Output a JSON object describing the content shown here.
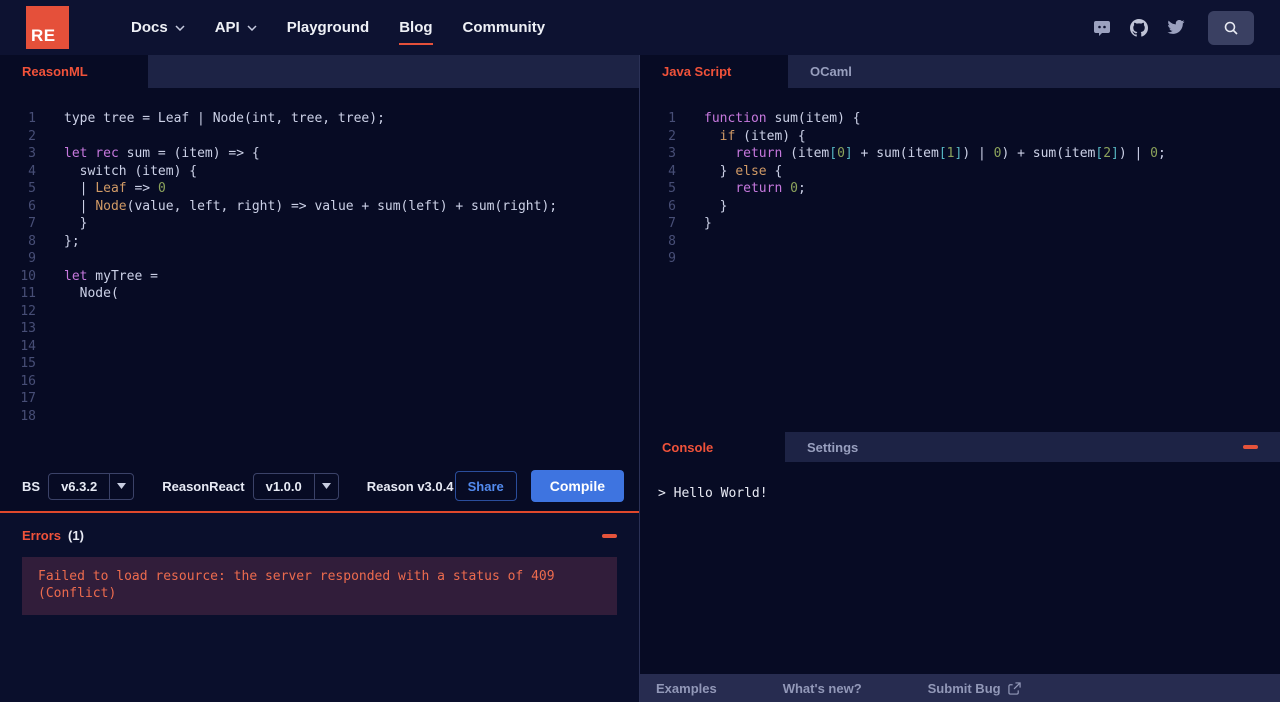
{
  "navbar": {
    "logo_text": "RE",
    "links": [
      {
        "label": "Docs",
        "caret": true,
        "active": false
      },
      {
        "label": "API",
        "caret": true,
        "active": false
      },
      {
        "label": "Playground",
        "caret": false,
        "active": false
      },
      {
        "label": "Blog",
        "caret": false,
        "active": true
      },
      {
        "label": "Community",
        "caret": false,
        "active": false
      }
    ],
    "icons": [
      "discord-icon",
      "github-icon",
      "twitter-icon",
      "search-icon"
    ]
  },
  "left_editor": {
    "tab_label": "ReasonML",
    "lines": [
      [
        {
          "c": "p",
          "t": "type tree = Leaf | Node(int, tree, tree);"
        }
      ],
      [],
      [
        {
          "c": "k",
          "t": "let rec"
        },
        {
          "c": "p",
          "t": " sum = (item) => {"
        }
      ],
      [
        {
          "c": "p",
          "t": "  switch (item) {"
        }
      ],
      [
        {
          "c": "p",
          "t": "  | "
        },
        {
          "c": "v",
          "t": "Leaf"
        },
        {
          "c": "p",
          "t": " => "
        },
        {
          "c": "n",
          "t": "0"
        }
      ],
      [
        {
          "c": "p",
          "t": "  | "
        },
        {
          "c": "v",
          "t": "Node"
        },
        {
          "c": "p",
          "t": "(value, left, right) => value + sum(left) + sum(right);"
        }
      ],
      [
        {
          "c": "p",
          "t": "  }"
        }
      ],
      [
        {
          "c": "p",
          "t": "};"
        }
      ],
      [],
      [
        {
          "c": "k",
          "t": "let"
        },
        {
          "c": "p",
          "t": " myTree ="
        }
      ],
      [
        {
          "c": "p",
          "t": "  Node("
        }
      ],
      [],
      [],
      [],
      [],
      [],
      [],
      []
    ]
  },
  "right_editor": {
    "tabs": [
      {
        "label": "Java Script"
      },
      {
        "label": "OCaml"
      }
    ],
    "lines": [
      [
        {
          "c": "k",
          "t": "function"
        },
        {
          "c": "p",
          "t": " sum(item) {"
        }
      ],
      [
        {
          "c": "p",
          "t": "  "
        },
        {
          "c": "v",
          "t": "if"
        },
        {
          "c": "p",
          "t": " (item) {"
        }
      ],
      [
        {
          "c": "p",
          "t": "    "
        },
        {
          "c": "k",
          "t": "return"
        },
        {
          "c": "p",
          "t": " (item"
        },
        {
          "c": "b",
          "t": "["
        },
        {
          "c": "n",
          "t": "0"
        },
        {
          "c": "b",
          "t": "]"
        },
        {
          "c": "p",
          "t": " + sum(item"
        },
        {
          "c": "b",
          "t": "["
        },
        {
          "c": "n",
          "t": "1"
        },
        {
          "c": "b",
          "t": "]"
        },
        {
          "c": "p",
          "t": ") | "
        },
        {
          "c": "n",
          "t": "0"
        },
        {
          "c": "p",
          "t": ") + sum(item"
        },
        {
          "c": "b",
          "t": "["
        },
        {
          "c": "n",
          "t": "2"
        },
        {
          "c": "b",
          "t": "]"
        },
        {
          "c": "p",
          "t": ") | "
        },
        {
          "c": "n",
          "t": "0"
        },
        {
          "c": "p",
          "t": ";"
        }
      ],
      [
        {
          "c": "p",
          "t": "  } "
        },
        {
          "c": "v",
          "t": "else"
        },
        {
          "c": "p",
          "t": " {"
        }
      ],
      [
        {
          "c": "p",
          "t": "    "
        },
        {
          "c": "k",
          "t": "return"
        },
        {
          "c": "p",
          "t": " "
        },
        {
          "c": "n",
          "t": "0"
        },
        {
          "c": "p",
          "t": ";"
        }
      ],
      [
        {
          "c": "p",
          "t": "  }"
        }
      ],
      [
        {
          "c": "p",
          "t": "}"
        }
      ],
      [],
      []
    ]
  },
  "toolbar": {
    "bs_label": "BS",
    "bs_version": "v6.3.2",
    "reason_react_label": "ReasonReact",
    "reason_react_version": "v1.0.0",
    "reason_version": "Reason v3.0.4",
    "share_label": "Share",
    "compile_label": "Compile"
  },
  "errors": {
    "title": "Errors",
    "count": "(1)",
    "message": "Failed to load resource: the server responded with a status of 409 (Conflict)"
  },
  "console": {
    "tabs": [
      {
        "label": "Console"
      },
      {
        "label": "Settings"
      }
    ],
    "output": "> Hello World!"
  },
  "footer": {
    "links": [
      {
        "label": "Examples",
        "external": false
      },
      {
        "label": "What's new?",
        "external": false
      },
      {
        "label": "Submit Bug",
        "external": true
      }
    ]
  },
  "colors": {
    "accent_orange": "#e5503a",
    "tab_active_text": "#f0523a",
    "compile_blue": "#3e74e0",
    "share_blue": "#538bef",
    "error_text": "#ed6b4e",
    "error_box_bg": "#311d3a"
  }
}
